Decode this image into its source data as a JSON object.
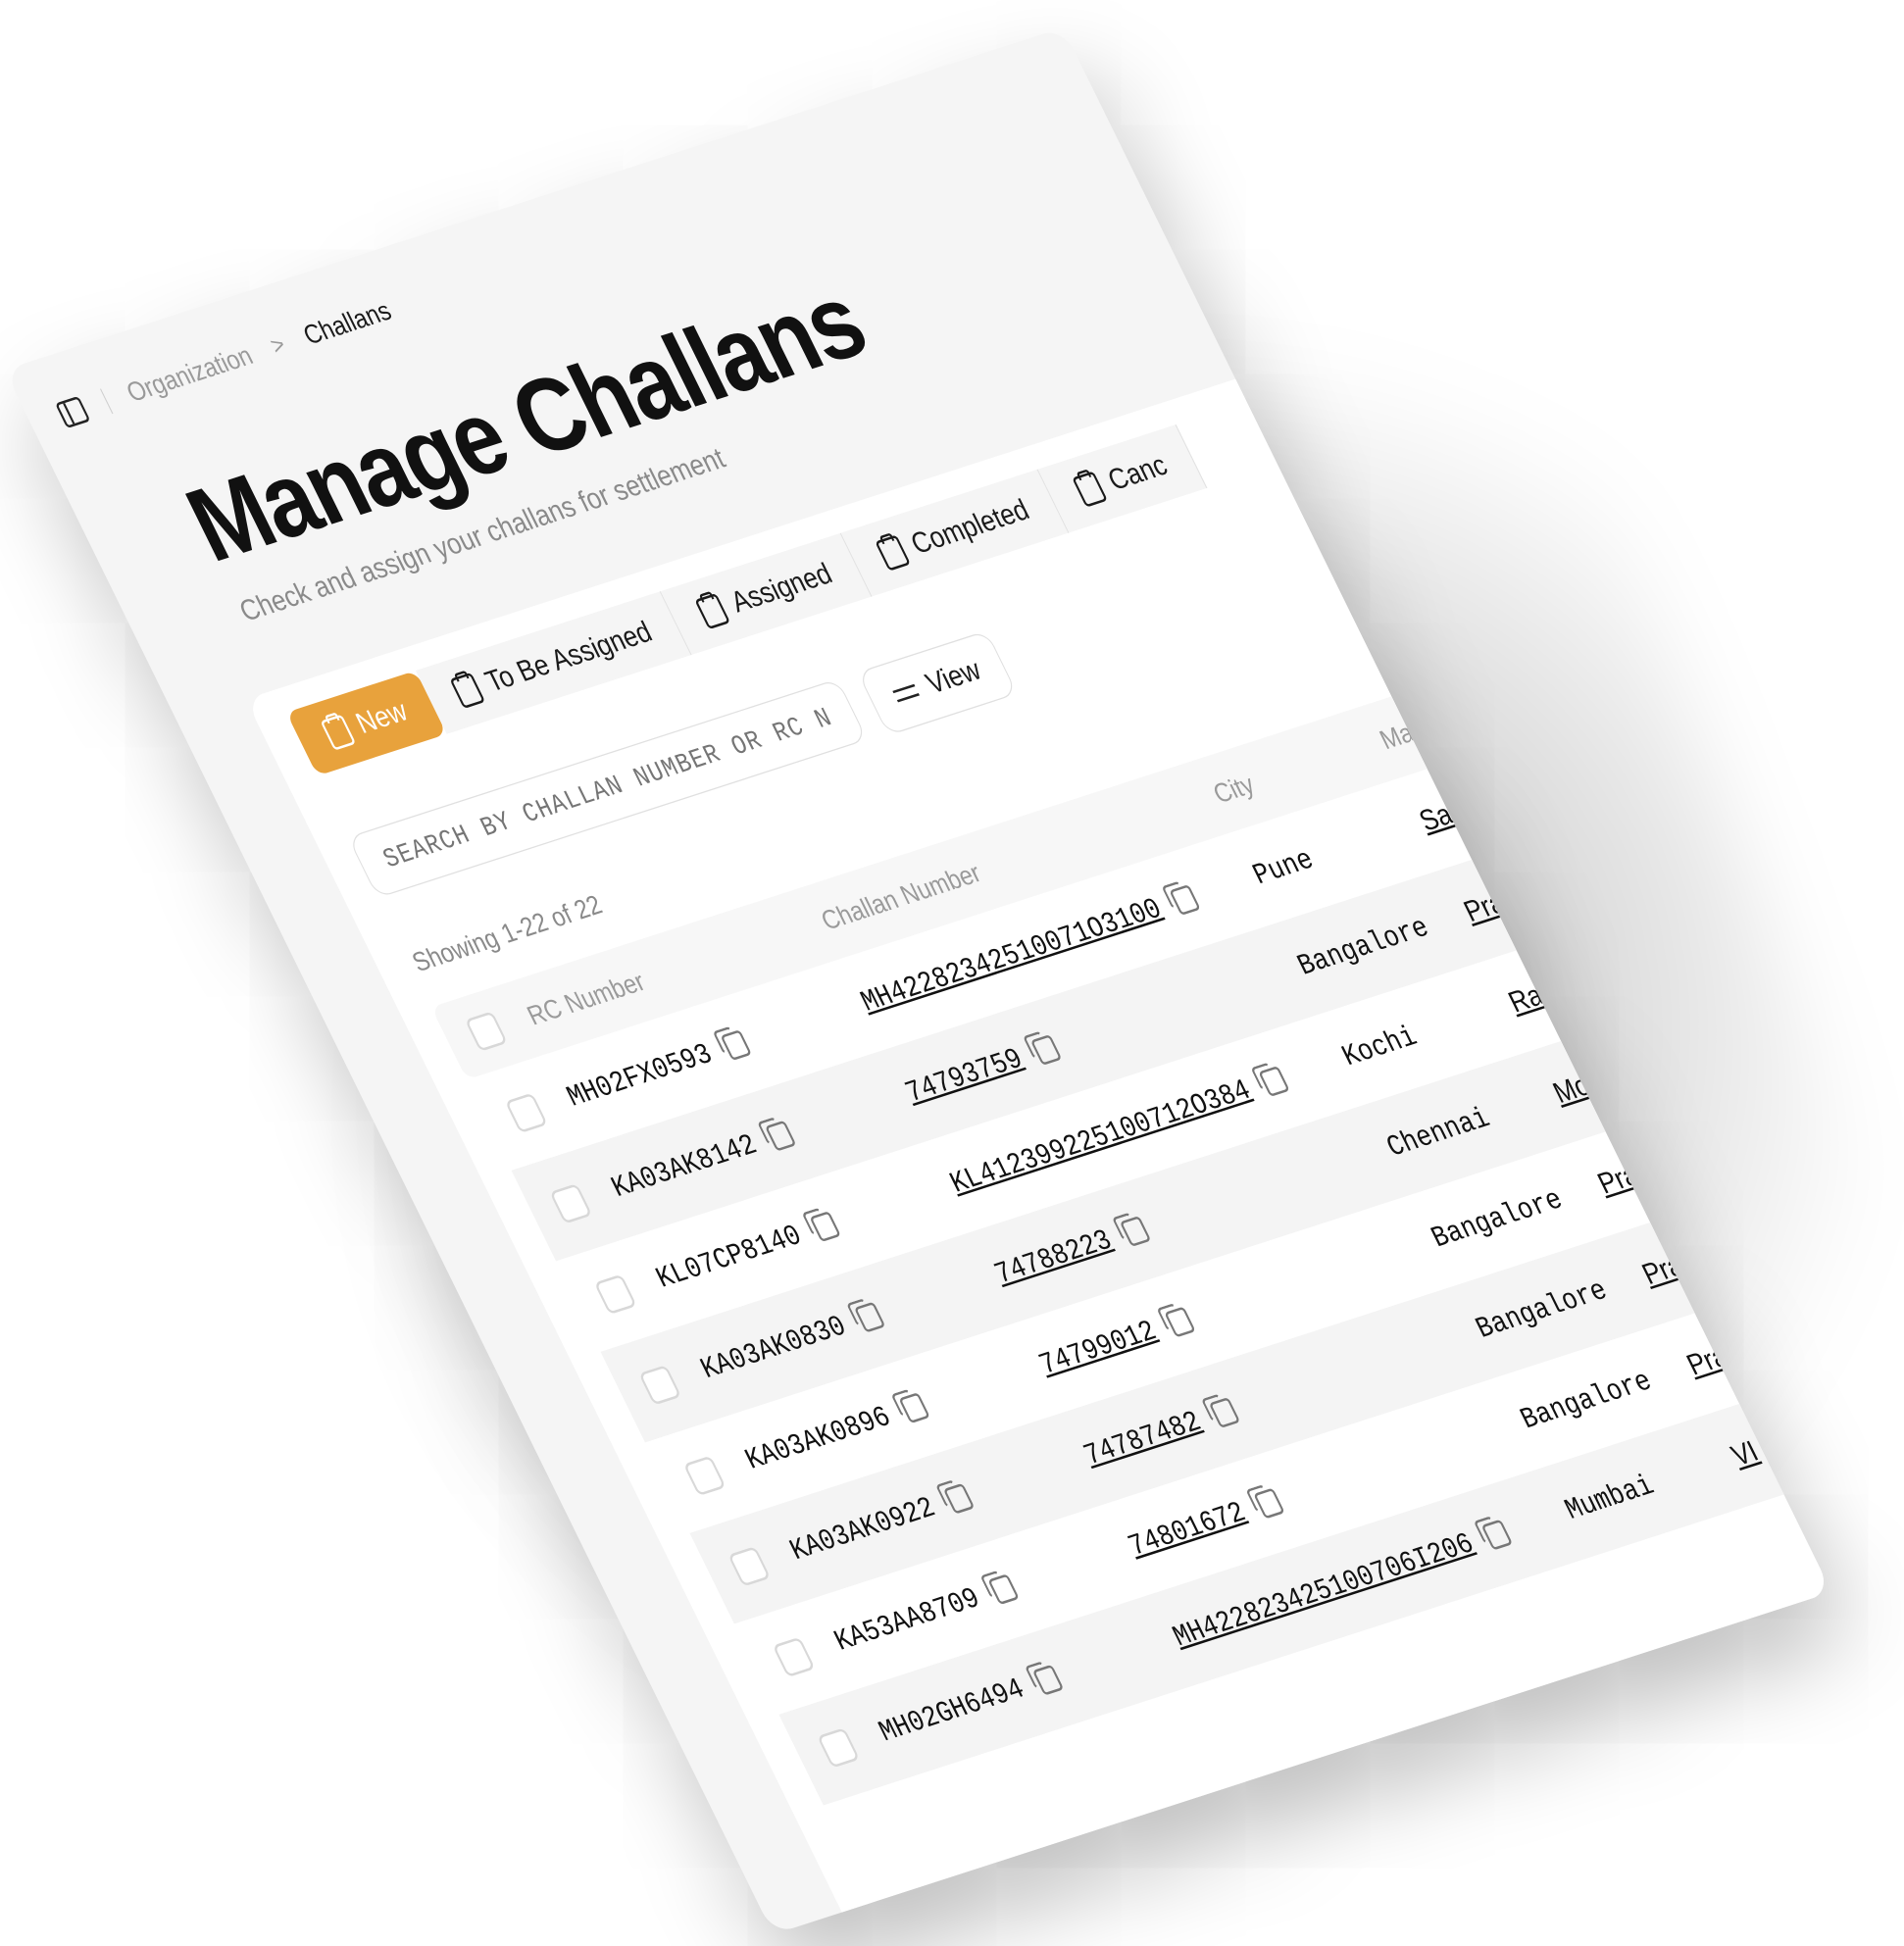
{
  "breadcrumb": {
    "root": "Organization",
    "separator": ">",
    "current": "Challans"
  },
  "page": {
    "title": "Manage Challans",
    "subtitle": "Check and assign your challans for settlement"
  },
  "tabs": [
    {
      "label": "New",
      "active": true
    },
    {
      "label": "To Be Assigned",
      "active": false
    },
    {
      "label": "Assigned",
      "active": false
    },
    {
      "label": "Completed",
      "active": false
    },
    {
      "label": "Canc",
      "active": false
    }
  ],
  "search": {
    "placeholder": "SEARCH BY CHALLAN NUMBER OR RC NU"
  },
  "view_button": {
    "label": "View"
  },
  "showing": "Showing 1-22 of 22",
  "columns": {
    "rc": "RC Number",
    "challan": "Challan Number",
    "city": "City",
    "manager": "Man"
  },
  "rows": [
    {
      "rc": "MH02FX0593",
      "challan": "MH42282342510071O3100",
      "city": "Pune",
      "manager": "Sa"
    },
    {
      "rc": "KA03AK8142",
      "challan": "74793759",
      "city": "Bangalore",
      "manager": "Pra"
    },
    {
      "rc": "KL07CP8140",
      "challan": "KL412399225100712O384",
      "city": "Kochi",
      "manager": "Ra"
    },
    {
      "rc": "KA03AK0830",
      "challan": "74788223",
      "city": "Chennai",
      "manager": "Mo"
    },
    {
      "rc": "KA03AK0896",
      "challan": "74799012",
      "city": "Bangalore",
      "manager": "Pra"
    },
    {
      "rc": "KA03AK0922",
      "challan": "74787482",
      "city": "Bangalore",
      "manager": "Pra"
    },
    {
      "rc": "KA53AA8709",
      "challan": "74801672",
      "city": "Bangalore",
      "manager": "Pra"
    },
    {
      "rc": "MH02GH6494",
      "challan": "MH422823425100706I206",
      "city": "Mumbai",
      "manager": "VI"
    }
  ],
  "colors": {
    "accent": "#e8a23c",
    "background": "#f5f5f5"
  },
  "icons": [
    "sidebar-toggle-icon",
    "clipboard-icon",
    "user-check-icon",
    "clipboard-check-icon",
    "cancel-icon",
    "filter-icon",
    "copy-icon"
  ]
}
